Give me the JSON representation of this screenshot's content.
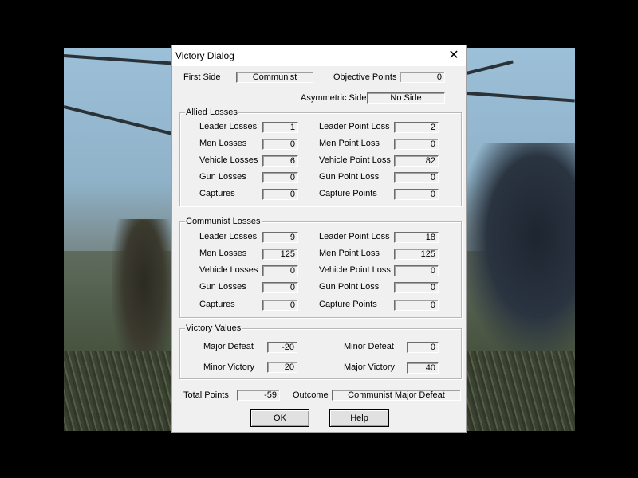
{
  "dialog": {
    "title": "Victory Dialog",
    "close_glyph": "✕"
  },
  "top": {
    "first_side_label": "First Side",
    "first_side_value": "Communist",
    "objective_points_label": "Objective Points",
    "objective_points_value": "0",
    "asymmetric_side_label": "Asymmetric Side",
    "asymmetric_side_value": "No Side"
  },
  "allied_losses": {
    "title": "Allied Losses",
    "rows": [
      {
        "label": "Leader Losses",
        "value": "1",
        "point_label": "Leader Point Loss",
        "point_value": "2"
      },
      {
        "label": "Men Losses",
        "value": "0",
        "point_label": "Men Point Loss",
        "point_value": "0"
      },
      {
        "label": "Vehicle Losses",
        "value": "6",
        "point_label": "Vehicle Point Loss",
        "point_value": "82"
      },
      {
        "label": "Gun Losses",
        "value": "0",
        "point_label": "Gun Point Loss",
        "point_value": "0"
      },
      {
        "label": "Captures",
        "value": "0",
        "point_label": "Capture Points",
        "point_value": "0"
      }
    ]
  },
  "communist_losses": {
    "title": "Communist Losses",
    "rows": [
      {
        "label": "Leader Losses",
        "value": "9",
        "point_label": "Leader Point Loss",
        "point_value": "18"
      },
      {
        "label": "Men Losses",
        "value": "125",
        "point_label": "Men Point Loss",
        "point_value": "125"
      },
      {
        "label": "Vehicle Losses",
        "value": "0",
        "point_label": "Vehicle Point Loss",
        "point_value": "0"
      },
      {
        "label": "Gun Losses",
        "value": "0",
        "point_label": "Gun Point Loss",
        "point_value": "0"
      },
      {
        "label": "Captures",
        "value": "0",
        "point_label": "Capture Points",
        "point_value": "0"
      }
    ]
  },
  "victory_values": {
    "title": "Victory Values",
    "major_defeat_label": "Major Defeat",
    "major_defeat_value": "-20",
    "minor_defeat_label": "Minor Defeat",
    "minor_defeat_value": "0",
    "minor_victory_label": "Minor Victory",
    "minor_victory_value": "20",
    "major_victory_label": "Major Victory",
    "major_victory_value": "40"
  },
  "summary": {
    "total_points_label": "Total Points",
    "total_points_value": "-59",
    "outcome_label": "Outcome",
    "outcome_value": "Communist Major Defeat"
  },
  "buttons": {
    "ok_label": "OK",
    "help_label": "Help"
  }
}
